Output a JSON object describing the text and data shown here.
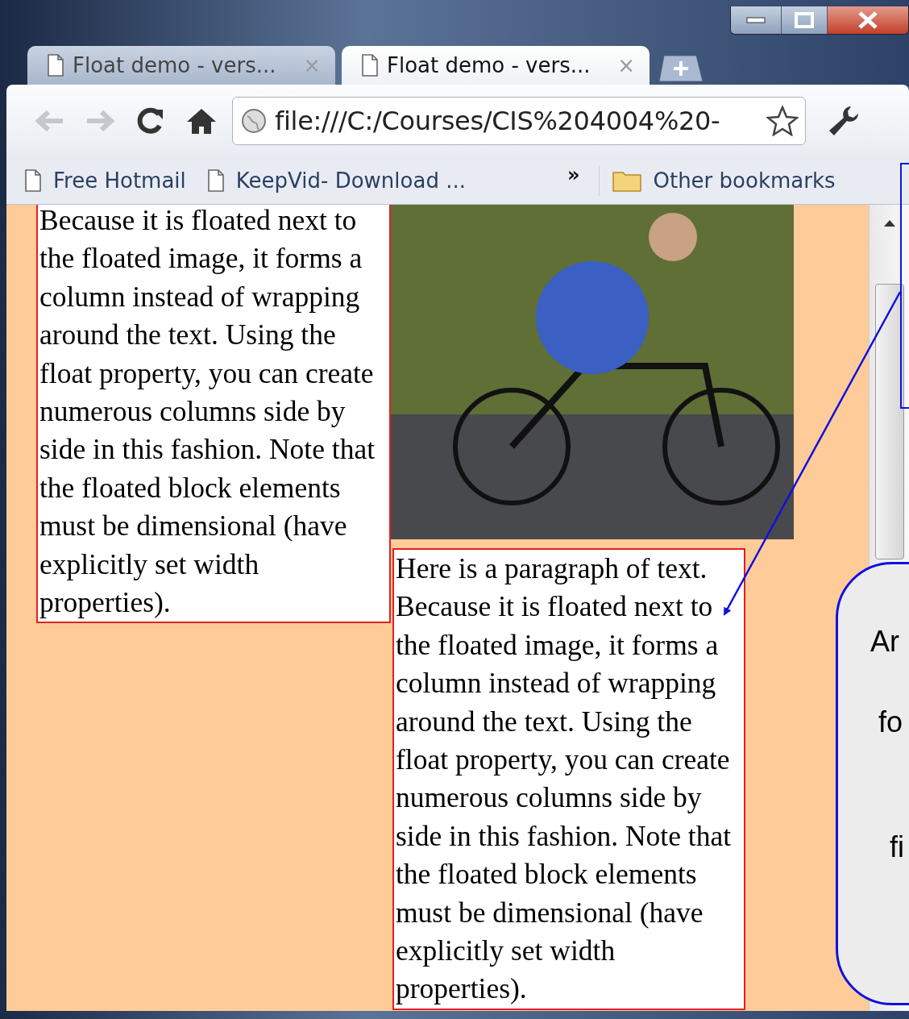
{
  "tabs": [
    {
      "label": "Float demo - vers...",
      "close": "×",
      "selected": false
    },
    {
      "label": "Float demo - vers...",
      "close": "×",
      "selected": true
    }
  ],
  "address_bar": {
    "url": "file:///C:/Courses/CIS%204004%20-"
  },
  "bookmarks": [
    {
      "label": "Free Hotmail"
    },
    {
      "label": "KeepVid- Download ..."
    }
  ],
  "bookmarks_overflow": "»",
  "other_bookmarks": "Other bookmarks",
  "page": {
    "paragraph_1": "Because it is floated next to the floated image, it forms a column instead of wrapping around the text. Using the float property, you can create numerous columns side by side in this fashion. Note that the floated block elements must be dimensional (have explicitly set width properties).",
    "paragraph_2": "Here is a paragraph of text. Because it is floated next to the floated image, it forms a column instead of wrapping around the text. Using the float property, you can create numerous columns side by side in this fashion. Note that the floated block elements must be dimensional (have explicitly set width properties)."
  },
  "callout": {
    "lines": [
      "Ar",
      "fo",
      "fi"
    ]
  }
}
